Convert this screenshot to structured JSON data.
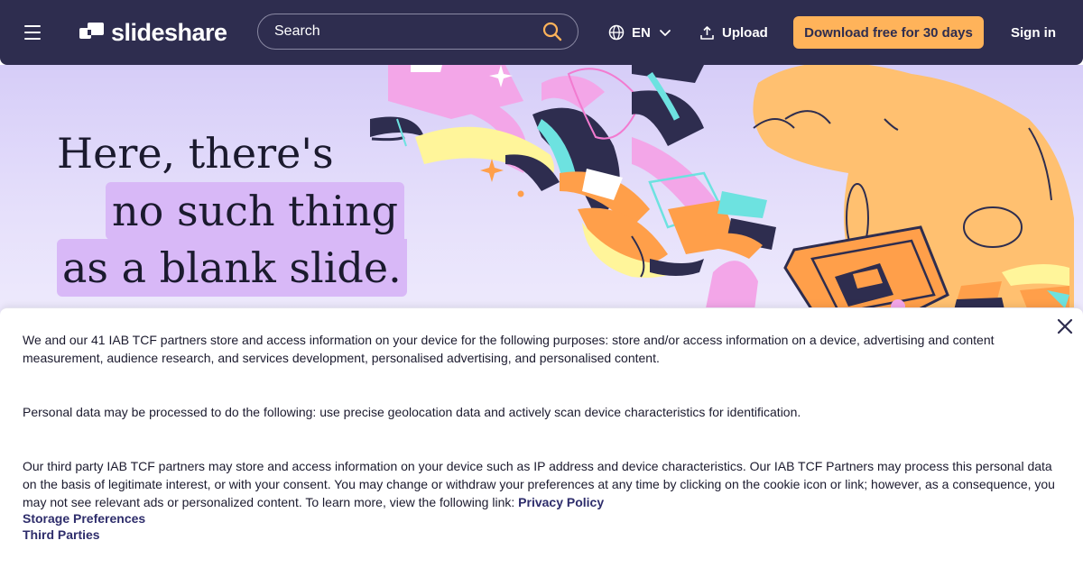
{
  "header": {
    "brand": "slideshare",
    "search_placeholder": "Search",
    "language": "EN",
    "upload_label": "Upload",
    "download_label": "Download free for 30 days",
    "signin_label": "Sign in"
  },
  "hero": {
    "line1": "Here, there's",
    "line2": "no such thing",
    "line3": "as a blank slide."
  },
  "consent": {
    "paragraph1": "We and our 41 IAB TCF partners store and access information on your device for the following purposes: store and/or access information on a device, advertising and content measurement, audience research, and services development, personalised advertising, and personalised content.",
    "paragraph2": "Personal data may be processed to do the following: use precise geolocation data and actively scan device characteristics for identification.",
    "paragraph3": "Our third party IAB TCF partners may store and access information on your device such as IP address and device characteristics. Our IAB TCF Partners may process this personal data on the basis of legitimate interest, or with your consent. You may change or withdraw your preferences at any time by clicking on the cookie icon or link; however, as a consequence, you may not see relevant ads or personalized content. To learn more, view the following link:",
    "privacy_link": "Privacy Policy",
    "storage_link": "Storage Preferences",
    "third_parties_link": "Third Parties"
  },
  "colors": {
    "header_bg": "#2e2d4f",
    "accent": "#ffb35a",
    "highlight": "#d8b8f7"
  },
  "icons": [
    "menu-icon",
    "slideshare-logo-icon",
    "search-icon",
    "globe-icon",
    "chevron-down-icon",
    "upload-icon",
    "close-icon"
  ]
}
